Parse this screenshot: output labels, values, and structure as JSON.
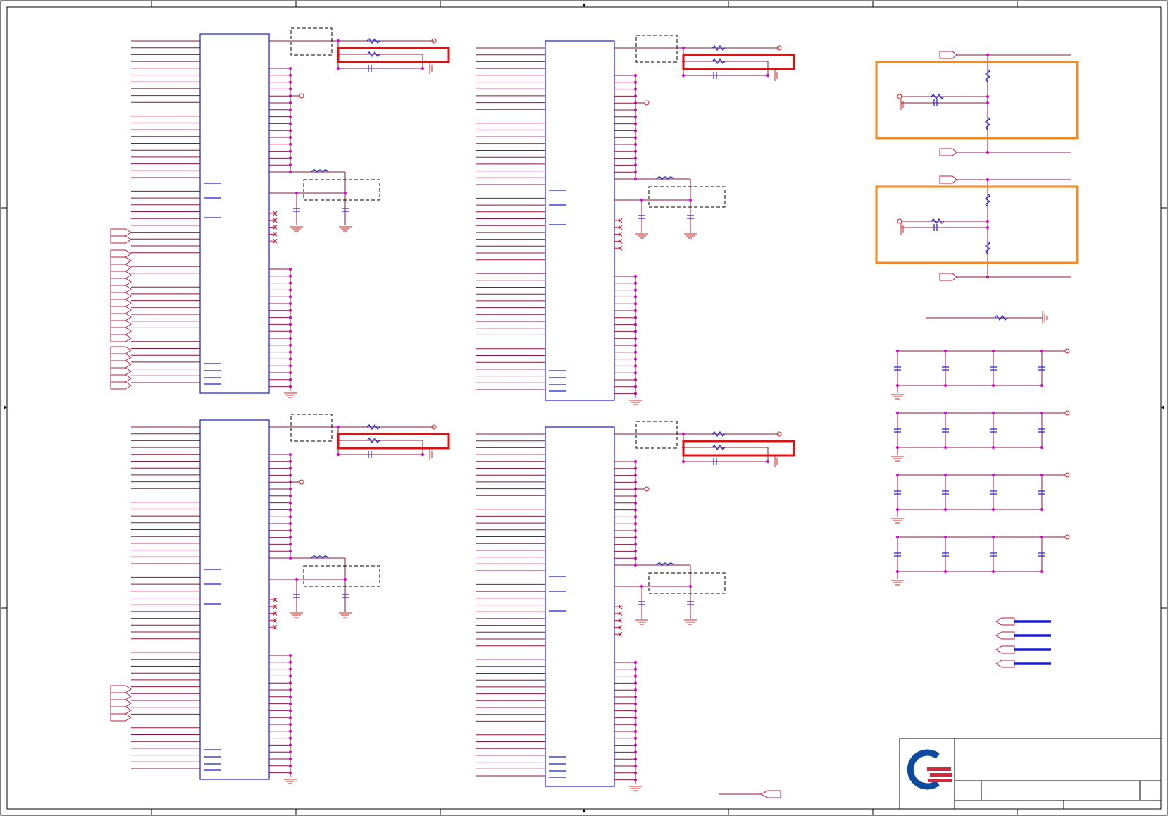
{
  "sheet": {
    "background": "#ffffff",
    "wire_color": "#8b1538",
    "pin_color": "#c21c3a",
    "part_color": "#1a1adb",
    "junction_color": "#e000e0",
    "highlight_primary": "#e41010",
    "highlight_secondary": "#f5891b"
  },
  "icons": {
    "logo": "company-logo-icon",
    "ground": "ground-symbol-icon",
    "resistor": "resistor-icon",
    "capacitor": "capacitor-icon",
    "inductor": "inductor-icon",
    "offpage": "offpage-connector-icon",
    "power": "power-port-icon"
  },
  "title_block": {
    "title": "",
    "sheet": ""
  }
}
